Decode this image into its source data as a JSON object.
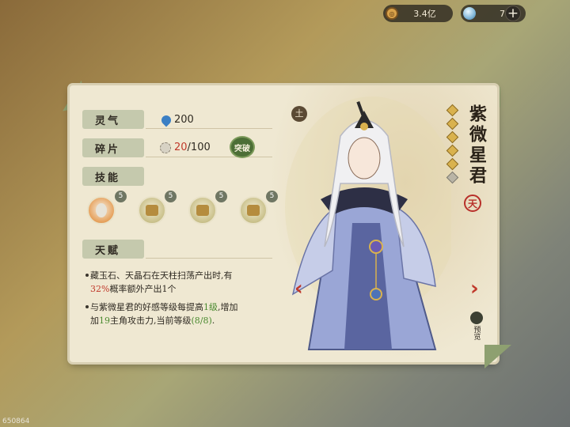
{
  "currency": {
    "coins": "3.4亿",
    "gems": "7"
  },
  "labels": {
    "lingqi": "灵气",
    "fragments": "碎片",
    "skills": "技能",
    "talent": "天赋",
    "breakthrough": "突破"
  },
  "values": {
    "lingqi": "200",
    "fragments_have": "20",
    "fragments_need": "/100"
  },
  "skills": [
    {
      "icon": "companion-portrait-icon",
      "level": "5"
    },
    {
      "icon": "field-harvest-icon",
      "level": "5"
    },
    {
      "icon": "field-plant-icon",
      "level": "5"
    },
    {
      "icon": "field-basket-icon",
      "level": "5"
    }
  ],
  "talents": [
    {
      "pre": "藏玉石、天晶石在天柱扫荡产出时,有",
      "hl": "32%",
      "post": "概率额外产出1个"
    },
    {
      "pre": "与紫微星君的好感等级每提高",
      "hl1": "1级",
      "mid": ",增加",
      "hl2": "19",
      "mid2": "主角攻击力,当前等级",
      "hl3": "(8/8)",
      "post": "."
    }
  ],
  "character": {
    "name": "紫微星君",
    "element": "土",
    "rank": "天",
    "stars_total": 6,
    "stars_filled": 5
  },
  "preview_label": "预览",
  "corner_id": "650864",
  "colors": {
    "accent_red": "#c0392b",
    "accent_green": "#4a8a2f",
    "tag_bg": "#c5c9ad",
    "panel_bg": "#efe8d2"
  }
}
